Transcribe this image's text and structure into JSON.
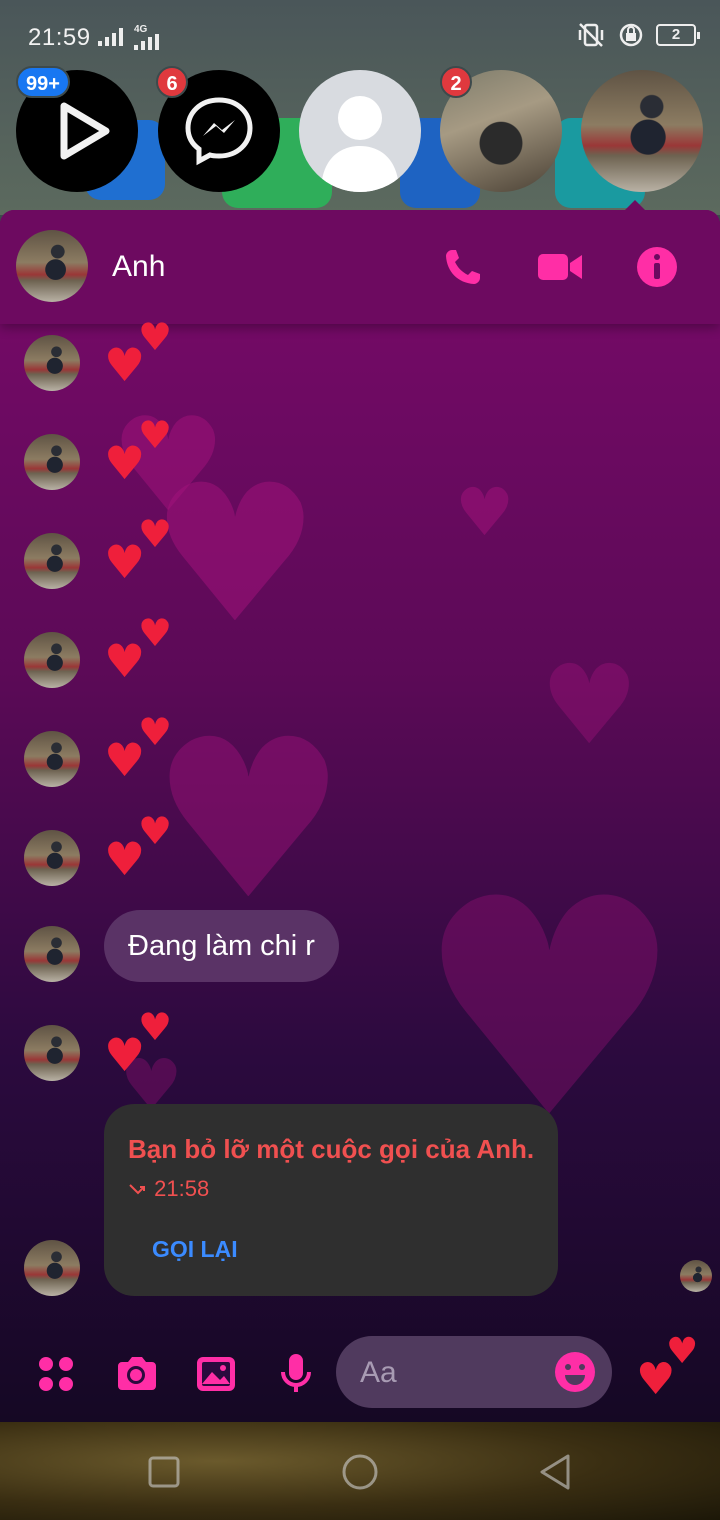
{
  "status_bar": {
    "time": "21:59",
    "network_type": "4G",
    "battery_level": "2"
  },
  "chat_heads": [
    {
      "name": "video-app-head",
      "badge": "99+",
      "badge_color": "#1877f2"
    },
    {
      "name": "messenger-head",
      "badge": "6",
      "badge_color": "#e0393e"
    },
    {
      "name": "contact-head-blank",
      "badge": "",
      "badge_color": ""
    },
    {
      "name": "contact-head-girl",
      "badge": "2",
      "badge_color": "#e0393e"
    },
    {
      "name": "contact-head-anh",
      "badge": "",
      "badge_color": ""
    }
  ],
  "conversation": {
    "contact_name": "Anh",
    "theme_accent": "#ff2ea6",
    "messages": [
      {
        "type": "heart"
      },
      {
        "type": "heart"
      },
      {
        "type": "heart"
      },
      {
        "type": "heart"
      },
      {
        "type": "heart"
      },
      {
        "type": "heart"
      },
      {
        "type": "text",
        "text": "Đang làm chi r"
      },
      {
        "type": "heart"
      }
    ],
    "missed_call": {
      "title": "Bạn bỏ lỡ một cuộc gọi của Anh.",
      "time": "21:58",
      "call_back_label": "GỌI LẠI"
    }
  },
  "composer": {
    "placeholder": "Aa",
    "icons": [
      "menu-dots-icon",
      "camera-icon",
      "gallery-icon",
      "microphone-icon",
      "emoji-icon",
      "heart-send-icon"
    ]
  },
  "header_icons": [
    "phone-icon",
    "video-call-icon",
    "info-icon"
  ],
  "nav_icons": [
    "recent-apps-icon",
    "home-icon",
    "back-icon"
  ]
}
